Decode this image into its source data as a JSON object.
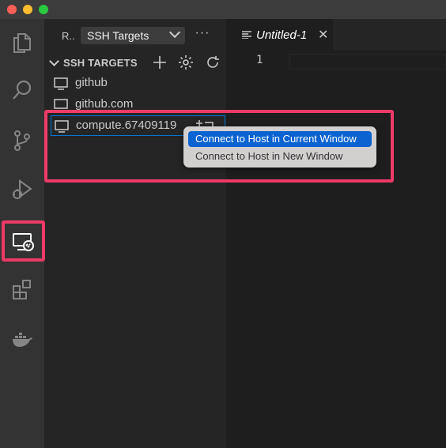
{
  "sidebar": {
    "view_short_label": "R..",
    "view_select_value": "SSH Targets",
    "more_actions": "···",
    "section_title": "SSH TARGETS",
    "targets": [
      {
        "label": "github"
      },
      {
        "label": "github.com"
      },
      {
        "label": "compute.67409119"
      }
    ]
  },
  "editor": {
    "tab_title": "Untitled-1",
    "tab_close": "✕",
    "line_number": "1"
  },
  "context_menu": {
    "items": [
      {
        "label": "Connect to Host in Current Window"
      },
      {
        "label": "Connect to Host in New Window"
      }
    ]
  },
  "theme": {
    "highlight_outline": "#ee3a68",
    "menu_selection": "#0a63d1"
  },
  "icons": {
    "activity_bar": [
      "files-icon",
      "search-icon",
      "source-control-icon",
      "run-debug-icon",
      "remote-explorer-icon",
      "extensions-icon",
      "docker-icon"
    ]
  }
}
